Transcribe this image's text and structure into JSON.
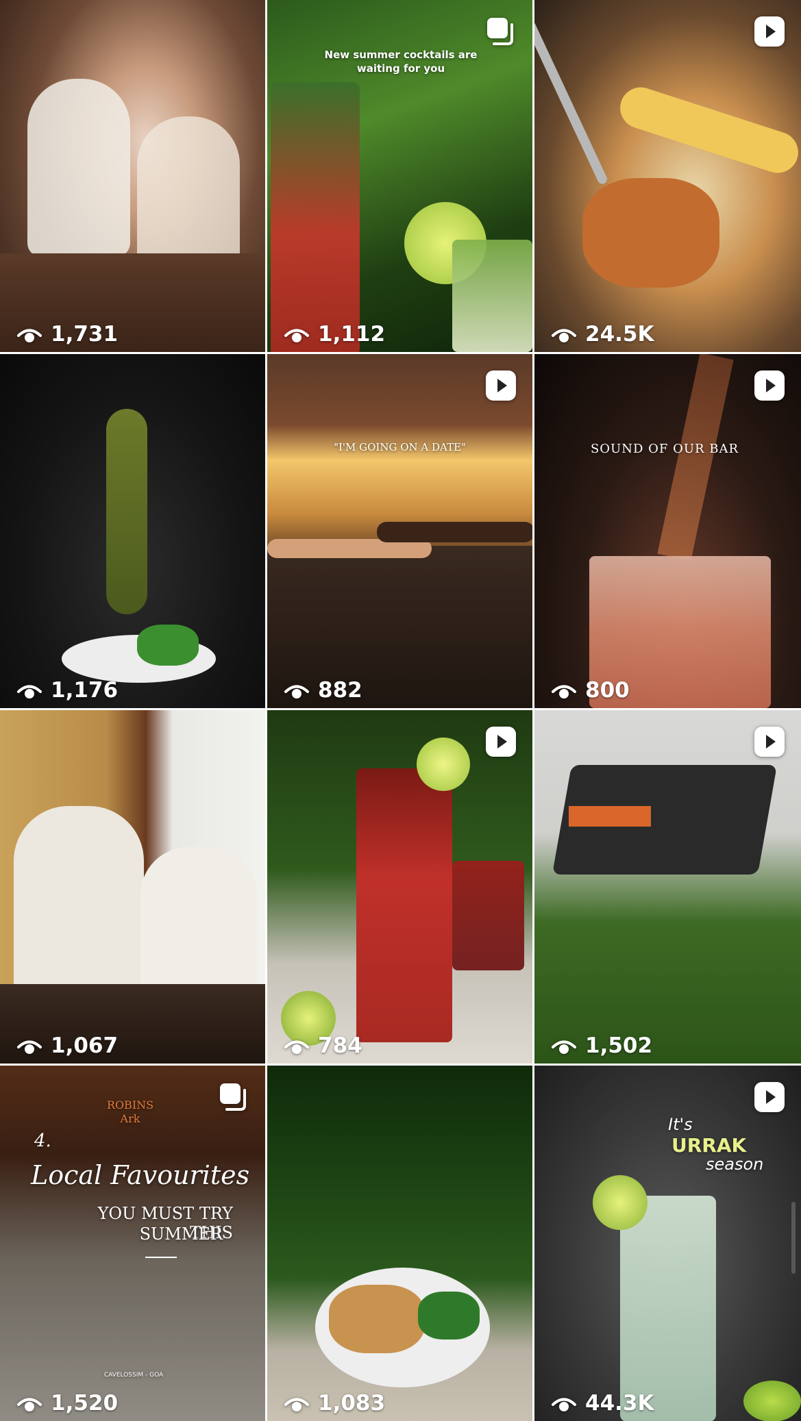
{
  "grid": {
    "tiles": [
      {
        "views": "1,731",
        "badge": "none",
        "description": "couple at restaurant table"
      },
      {
        "views": "1,112",
        "badge": "carousel",
        "overlay": "New summer cocktails are waiting for you"
      },
      {
        "views": "24.5K",
        "badge": "reel"
      },
      {
        "views": "1,176",
        "badge": "none"
      },
      {
        "views": "882",
        "badge": "reel",
        "overlay": "\"I'M GOING ON A DATE\""
      },
      {
        "views": "800",
        "badge": "reel",
        "overlay": "SOUND OF OUR BAR"
      },
      {
        "views": "1,067",
        "badge": "none"
      },
      {
        "views": "784",
        "badge": "reel"
      },
      {
        "views": "1,502",
        "badge": "reel"
      },
      {
        "views": "1,520",
        "badge": "carousel",
        "overlay_logo": "ROBINS Ark",
        "overlay_num": "4.",
        "overlay_title": "Local Favourites",
        "overlay_sub1": "YOU MUST TRY THIS",
        "overlay_sub2": "SUMMER",
        "overlay_loc": "CAVELOSSIM - GOA"
      },
      {
        "views": "1,083",
        "badge": "none"
      },
      {
        "views": "44.3K",
        "badge": "reel",
        "overlay_its": "It's",
        "overlay_urrak": "URRAK",
        "overlay_season": "season"
      }
    ]
  },
  "colors": {
    "divider": "#ffffff",
    "accent_urrak": "#e8f08a"
  },
  "icons": {
    "views": "eye-icon",
    "reel": "reel-icon",
    "carousel": "carousel-icon"
  }
}
